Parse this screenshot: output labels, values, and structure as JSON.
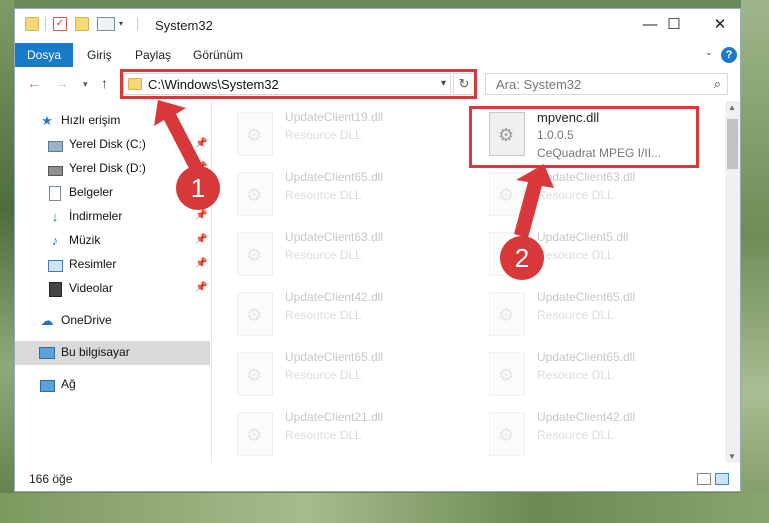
{
  "window": {
    "title": "System32",
    "controls": {
      "minimize": "—",
      "maximize": "☐",
      "close": "✕"
    }
  },
  "ribbon": {
    "tabs": [
      {
        "label": "Dosya",
        "active": true
      },
      {
        "label": "Giriş"
      },
      {
        "label": "Paylaş"
      },
      {
        "label": "Görünüm"
      }
    ],
    "help": "?"
  },
  "nav": {
    "address": "C:\\Windows\\System32",
    "search_placeholder": "Ara: System32"
  },
  "sidebar": {
    "items": [
      {
        "label": "Hızlı erişim",
        "icon": "star-icon"
      },
      {
        "label": "Yerel Disk (C:)",
        "icon": "drive-icon",
        "pinned": true
      },
      {
        "label": "Yerel Disk (D:)",
        "icon": "drive-icon",
        "pinned": true
      },
      {
        "label": "Belgeler",
        "icon": "documents-icon",
        "pinned": true
      },
      {
        "label": "İndirmeler",
        "icon": "download-icon",
        "pinned": true
      },
      {
        "label": "Müzik",
        "icon": "music-icon",
        "pinned": true
      },
      {
        "label": "Resimler",
        "icon": "pictures-icon",
        "pinned": true
      },
      {
        "label": "Videolar",
        "icon": "video-icon",
        "pinned": true
      },
      {
        "label": "OneDrive",
        "icon": "cloud-icon"
      },
      {
        "label": "Bu bilgisayar",
        "icon": "computer-icon",
        "selected": true
      },
      {
        "label": "Ağ",
        "icon": "network-icon"
      }
    ]
  },
  "files": {
    "left": [
      {
        "name": "UpdateClient19.dll",
        "type": "Resource DLL"
      },
      {
        "name": "UpdateClient65.dll",
        "type": "Resource DLL"
      },
      {
        "name": "UpdateClient63.dll",
        "type": "Resource DLL"
      },
      {
        "name": "UpdateClient42.dll",
        "type": "Resource DLL"
      },
      {
        "name": "UpdateClient65.dll",
        "type": "Resource DLL"
      },
      {
        "name": "UpdateClient21.dll",
        "type": "Resource DLL"
      }
    ],
    "right": [
      {
        "name": "mpvenc.dll",
        "version": "1.0.0.5",
        "company": "CeQuadrat MPEG I/II..."
      },
      {
        "name": "UpdateClient63.dll",
        "type": "Resource DLL"
      },
      {
        "name": "UpdateClient5.dll",
        "type": "Resource DLL"
      },
      {
        "name": "UpdateClient65.dll",
        "type": "Resource DLL"
      },
      {
        "name": "UpdateClient65.dll",
        "type": "Resource DLL"
      },
      {
        "name": "UpdateClient42.dll",
        "type": "Resource DLL"
      }
    ]
  },
  "status": {
    "count": "166 öğe"
  },
  "annotations": {
    "badge1": "1",
    "badge2": "2",
    "color": "#d9383a"
  }
}
